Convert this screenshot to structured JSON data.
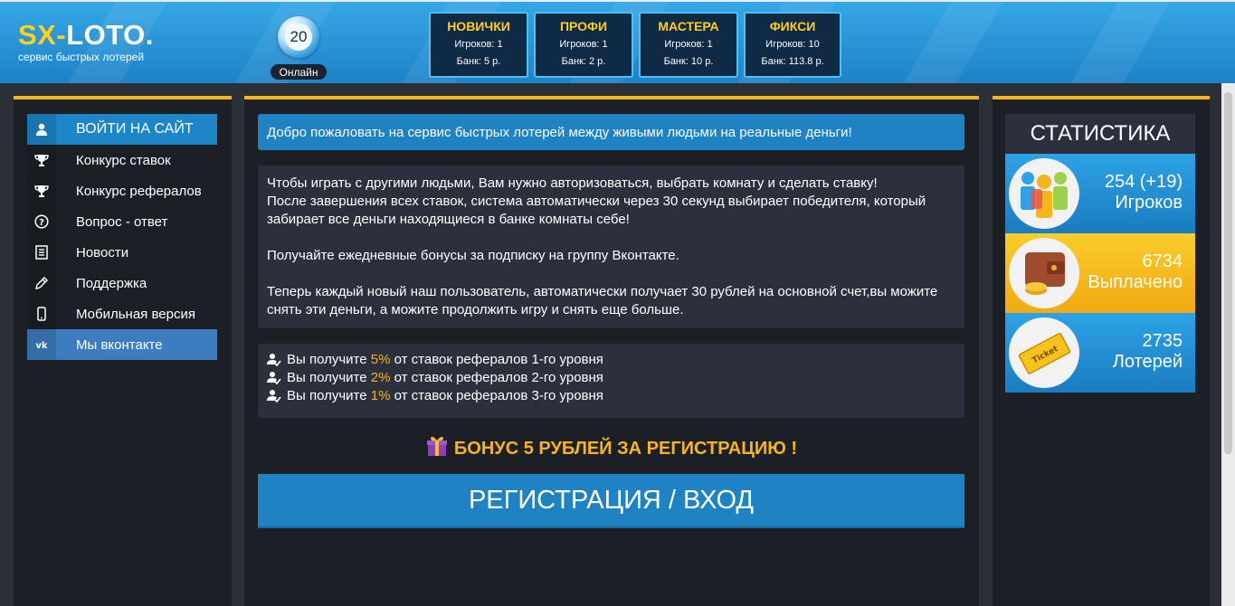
{
  "header": {
    "logo_part1": "SX-",
    "logo_part2": "LOTO.",
    "subtitle": "сервис быстрых лотерей",
    "online_count": "20",
    "online_label": "Онлайн",
    "rooms": [
      {
        "name": "НОВИЧКИ",
        "players": "Игроков: 1",
        "bank": "Банк: 5 р."
      },
      {
        "name": "ПРОФИ",
        "players": "Игроков: 1",
        "bank": "Банк: 2 р."
      },
      {
        "name": "МАСТЕРА",
        "players": "Игроков: 1",
        "bank": "Банк: 10 р."
      },
      {
        "name": "ФИКСИ",
        "players": "Игроков: 10",
        "bank": "Банк: 113.8 р."
      }
    ]
  },
  "menu": {
    "items": [
      {
        "label": "ВОЙТИ НА САЙТ",
        "icon": "user-icon"
      },
      {
        "label": "Конкурс ставок",
        "icon": "trophy-icon"
      },
      {
        "label": "Конкурс рефералов",
        "icon": "trophy-icon"
      },
      {
        "label": "Вопрос - ответ",
        "icon": "question-icon"
      },
      {
        "label": "Новости",
        "icon": "news-icon"
      },
      {
        "label": "Поддержка",
        "icon": "pencil-icon"
      },
      {
        "label": "Мобильная версия",
        "icon": "mobile-icon"
      },
      {
        "label": "Мы вконтакте",
        "icon": "vk-icon"
      }
    ]
  },
  "main": {
    "welcome": "Добро пожаловать на сервис быстрых лотерей между живыми людьми на реальные деньги!",
    "info_lines": [
      "Чтобы играть с другими людьми, Вам нужно авторизоваться, выбрать комнату и сделать ставку!",
      "После завершения всех ставок, система автоматически через 30 секунд выбирает победителя, который",
      "забирает все деньги находящиеся в банке комнаты себе!",
      "Получайте ежедневные бонусы за подписку на группу Вконтакте.",
      "Теперь каждый новый наш пользователь, автоматически получает 30 рублей на основной счет,вы можите",
      "снять эти деньги, а можите продолжить игру и снять еще больше."
    ],
    "referrals": [
      {
        "prefix": "Вы получите",
        "percent": "5%",
        "suffix": "от ставок рефералов 1-го уровня"
      },
      {
        "prefix": "Вы получите",
        "percent": "2%",
        "suffix": "от ставок рефералов 2-го уровня"
      },
      {
        "prefix": "Вы получите",
        "percent": "1%",
        "suffix": "от ставок рефералов 3-го уровня"
      }
    ],
    "bonus": "БОНУС 5 РУБЛЕЙ ЗА РЕГИСТРАЦИЮ !",
    "register_button": "РЕГИСТРАЦИЯ / ВХОД"
  },
  "stats": {
    "title": "СТАТИСТИКА",
    "items": [
      {
        "value": "254 (+19)",
        "label": "Игроков",
        "icon": "players-icon"
      },
      {
        "value": "6734",
        "label": "Выплачено",
        "icon": "wallet-icon"
      },
      {
        "value": "2735",
        "label": "Лотерей",
        "icon": "ticket-icon"
      }
    ],
    "ticket_text": "Ticket"
  },
  "colors": {
    "accent_yellow": "#f7b51c",
    "accent_blue": "#1f82c3",
    "panel_dark": "#2b303c"
  }
}
